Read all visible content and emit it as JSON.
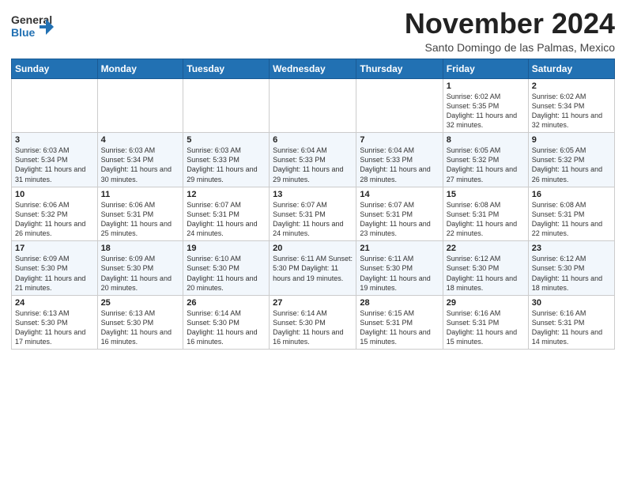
{
  "header": {
    "logo_general": "General",
    "logo_blue": "Blue",
    "month_title": "November 2024",
    "location": "Santo Domingo de las Palmas, Mexico"
  },
  "calendar": {
    "days_of_week": [
      "Sunday",
      "Monday",
      "Tuesday",
      "Wednesday",
      "Thursday",
      "Friday",
      "Saturday"
    ],
    "weeks": [
      [
        {
          "day": "",
          "info": ""
        },
        {
          "day": "",
          "info": ""
        },
        {
          "day": "",
          "info": ""
        },
        {
          "day": "",
          "info": ""
        },
        {
          "day": "",
          "info": ""
        },
        {
          "day": "1",
          "info": "Sunrise: 6:02 AM\nSunset: 5:35 PM\nDaylight: 11 hours and 32 minutes."
        },
        {
          "day": "2",
          "info": "Sunrise: 6:02 AM\nSunset: 5:34 PM\nDaylight: 11 hours and 32 minutes."
        }
      ],
      [
        {
          "day": "3",
          "info": "Sunrise: 6:03 AM\nSunset: 5:34 PM\nDaylight: 11 hours and 31 minutes."
        },
        {
          "day": "4",
          "info": "Sunrise: 6:03 AM\nSunset: 5:34 PM\nDaylight: 11 hours and 30 minutes."
        },
        {
          "day": "5",
          "info": "Sunrise: 6:03 AM\nSunset: 5:33 PM\nDaylight: 11 hours and 29 minutes."
        },
        {
          "day": "6",
          "info": "Sunrise: 6:04 AM\nSunset: 5:33 PM\nDaylight: 11 hours and 29 minutes."
        },
        {
          "day": "7",
          "info": "Sunrise: 6:04 AM\nSunset: 5:33 PM\nDaylight: 11 hours and 28 minutes."
        },
        {
          "day": "8",
          "info": "Sunrise: 6:05 AM\nSunset: 5:32 PM\nDaylight: 11 hours and 27 minutes."
        },
        {
          "day": "9",
          "info": "Sunrise: 6:05 AM\nSunset: 5:32 PM\nDaylight: 11 hours and 26 minutes."
        }
      ],
      [
        {
          "day": "10",
          "info": "Sunrise: 6:06 AM\nSunset: 5:32 PM\nDaylight: 11 hours and 26 minutes."
        },
        {
          "day": "11",
          "info": "Sunrise: 6:06 AM\nSunset: 5:31 PM\nDaylight: 11 hours and 25 minutes."
        },
        {
          "day": "12",
          "info": "Sunrise: 6:07 AM\nSunset: 5:31 PM\nDaylight: 11 hours and 24 minutes."
        },
        {
          "day": "13",
          "info": "Sunrise: 6:07 AM\nSunset: 5:31 PM\nDaylight: 11 hours and 24 minutes."
        },
        {
          "day": "14",
          "info": "Sunrise: 6:07 AM\nSunset: 5:31 PM\nDaylight: 11 hours and 23 minutes."
        },
        {
          "day": "15",
          "info": "Sunrise: 6:08 AM\nSunset: 5:31 PM\nDaylight: 11 hours and 22 minutes."
        },
        {
          "day": "16",
          "info": "Sunrise: 6:08 AM\nSunset: 5:31 PM\nDaylight: 11 hours and 22 minutes."
        }
      ],
      [
        {
          "day": "17",
          "info": "Sunrise: 6:09 AM\nSunset: 5:30 PM\nDaylight: 11 hours and 21 minutes."
        },
        {
          "day": "18",
          "info": "Sunrise: 6:09 AM\nSunset: 5:30 PM\nDaylight: 11 hours and 20 minutes."
        },
        {
          "day": "19",
          "info": "Sunrise: 6:10 AM\nSunset: 5:30 PM\nDaylight: 11 hours and 20 minutes."
        },
        {
          "day": "20",
          "info": "Sunrise: 6:11 AM\nSunset: 5:30 PM\nDaylight: 11 hours and 19 minutes."
        },
        {
          "day": "21",
          "info": "Sunrise: 6:11 AM\nSunset: 5:30 PM\nDaylight: 11 hours and 19 minutes."
        },
        {
          "day": "22",
          "info": "Sunrise: 6:12 AM\nSunset: 5:30 PM\nDaylight: 11 hours and 18 minutes."
        },
        {
          "day": "23",
          "info": "Sunrise: 6:12 AM\nSunset: 5:30 PM\nDaylight: 11 hours and 18 minutes."
        }
      ],
      [
        {
          "day": "24",
          "info": "Sunrise: 6:13 AM\nSunset: 5:30 PM\nDaylight: 11 hours and 17 minutes."
        },
        {
          "day": "25",
          "info": "Sunrise: 6:13 AM\nSunset: 5:30 PM\nDaylight: 11 hours and 16 minutes."
        },
        {
          "day": "26",
          "info": "Sunrise: 6:14 AM\nSunset: 5:30 PM\nDaylight: 11 hours and 16 minutes."
        },
        {
          "day": "27",
          "info": "Sunrise: 6:14 AM\nSunset: 5:30 PM\nDaylight: 11 hours and 16 minutes."
        },
        {
          "day": "28",
          "info": "Sunrise: 6:15 AM\nSunset: 5:31 PM\nDaylight: 11 hours and 15 minutes."
        },
        {
          "day": "29",
          "info": "Sunrise: 6:16 AM\nSunset: 5:31 PM\nDaylight: 11 hours and 15 minutes."
        },
        {
          "day": "30",
          "info": "Sunrise: 6:16 AM\nSunset: 5:31 PM\nDaylight: 11 hours and 14 minutes."
        }
      ]
    ]
  }
}
